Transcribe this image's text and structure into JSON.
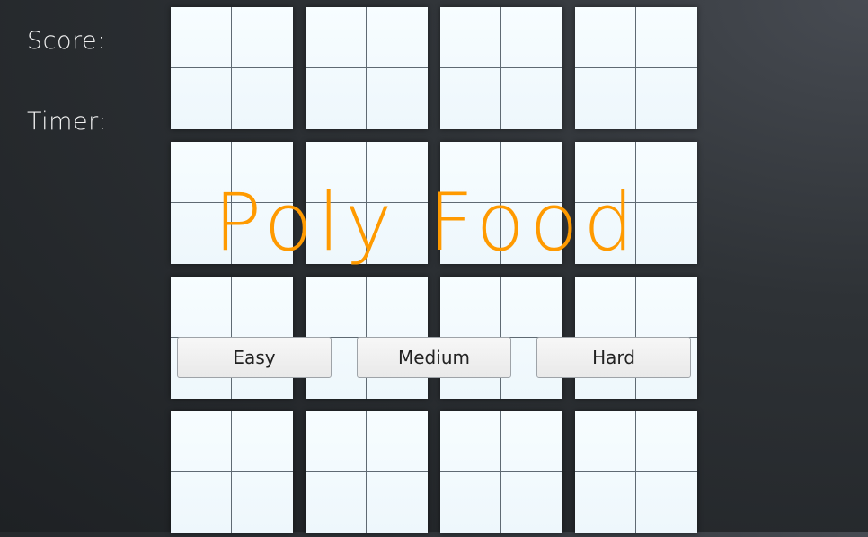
{
  "hud": {
    "score_label": "Score:",
    "timer_label": "Timer:"
  },
  "title": "Poly Food",
  "difficulty_buttons": {
    "easy": "Easy",
    "medium": "Medium",
    "hard": "Hard"
  },
  "colors": {
    "title": "#ff9a00",
    "background": "#2a2d31",
    "cell": "#f4fbff"
  }
}
